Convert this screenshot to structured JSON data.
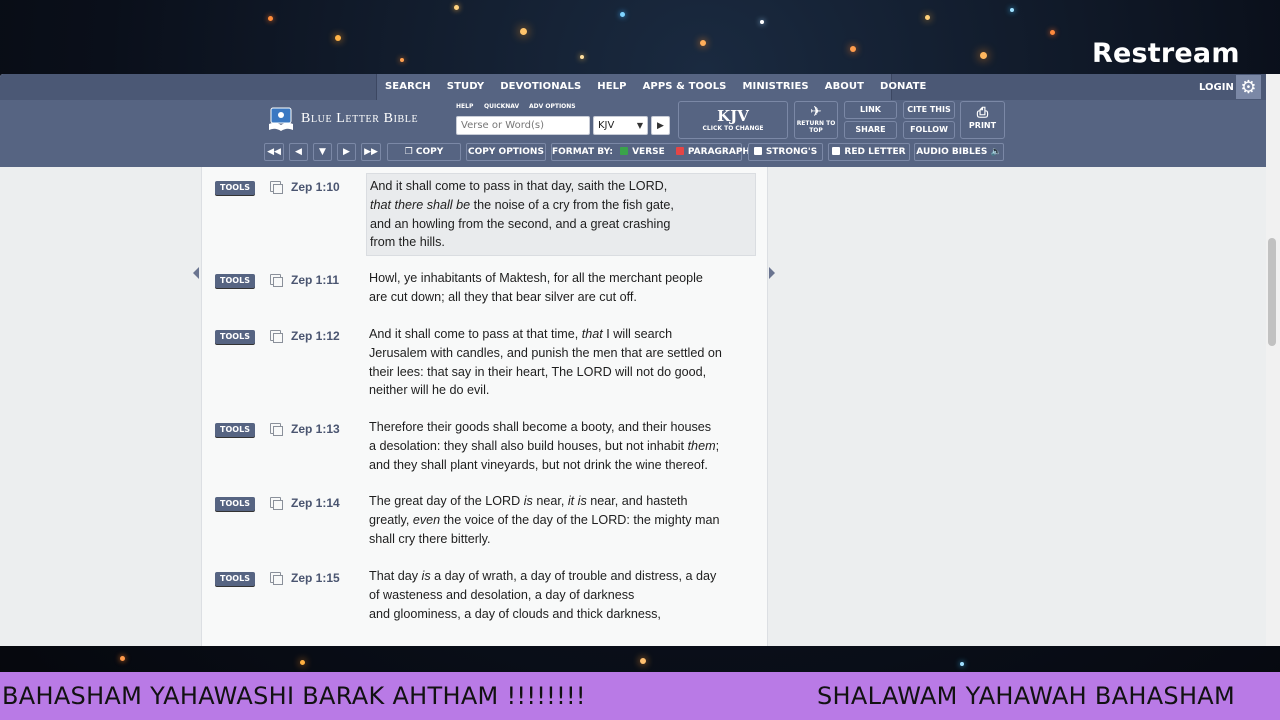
{
  "overlay": {
    "brand": "Restream",
    "ticker_left": "BAHASHAM YAHAWASHI BARAK AHTHAM !!!!!!!!",
    "ticker_right": "SHALAWAM YAHAWAH BAHASHAM"
  },
  "nav": {
    "items": [
      "SEARCH",
      "STUDY",
      "DEVOTIONALS",
      "HELP",
      "APPS & TOOLS",
      "MINISTRIES",
      "ABOUT",
      "DONATE"
    ],
    "login": "LOGIN"
  },
  "toolbar": {
    "brand": "Blue Letter Bible",
    "help": "HELP",
    "quicknav": "QUICKNAV",
    "adv_options": "ADV OPTIONS",
    "search_placeholder": "Verse or Word(s)",
    "version": "KJV",
    "kjv_label": "KJV",
    "kjv_sub": "CLICK TO CHANGE",
    "return_to_top": "RETURN TO TOP",
    "link": "LINK",
    "share": "SHARE",
    "cite": "CITE THIS",
    "follow": "FOLLOW",
    "print": "PRINT",
    "copy": "COPY",
    "copy_options": "COPY OPTIONS",
    "format_by": "FORMAT BY:",
    "verse": "VERSE",
    "paragraph": "PARAGRAPH",
    "strongs": "STRONG'S",
    "red_letter": "RED LETTER",
    "audio_bibles": "AUDIO BIBLES"
  },
  "verses": [
    {
      "ref": "Zep 1:10",
      "tools": "TOOLS",
      "html": "And it shall come to pass in that day, saith the LORD,<br><i>that there shall be</i> the noise of a cry from the fish gate,<br>and an howling from the second, and a great crashing<br>from the hills."
    },
    {
      "ref": "Zep 1:11",
      "tools": "TOOLS",
      "html": "Howl, ye inhabitants of Maktesh, for all the merchant people<br>are cut down; all they that bear silver are cut off."
    },
    {
      "ref": "Zep 1:12",
      "tools": "TOOLS",
      "html": "And it shall come to pass at that time, <i>that</i> I will search<br>Jerusalem with candles, and punish the men that are settled on<br>their lees: that say in their heart, The LORD will not do good,<br>neither will he do evil."
    },
    {
      "ref": "Zep 1:13",
      "tools": "TOOLS",
      "html": "Therefore their goods shall become a booty, and their houses<br>a desolation: they shall also build houses, but not inhabit <i>them</i>;<br>and they shall plant vineyards, but not drink the wine thereof."
    },
    {
      "ref": "Zep 1:14",
      "tools": "TOOLS",
      "html": "The great day of the LORD <i>is</i> near, <i>it is</i> near, and hasteth<br>greatly, <i>even</i> the voice of the day of the LORD: the mighty man<br>shall cry there bitterly."
    },
    {
      "ref": "Zep 1:15",
      "tools": "TOOLS",
      "html": "That day <i>is</i> a day of wrath, a day of trouble and distress, a day<br>of wasteness and desolation, a day of darkness<br>and gloominess, a day of clouds and thick darkness,"
    }
  ],
  "colors": {
    "nav_bg": "#4b5875",
    "toolbar_bg": "#566482",
    "ticker_bg": "#b97ae6"
  }
}
